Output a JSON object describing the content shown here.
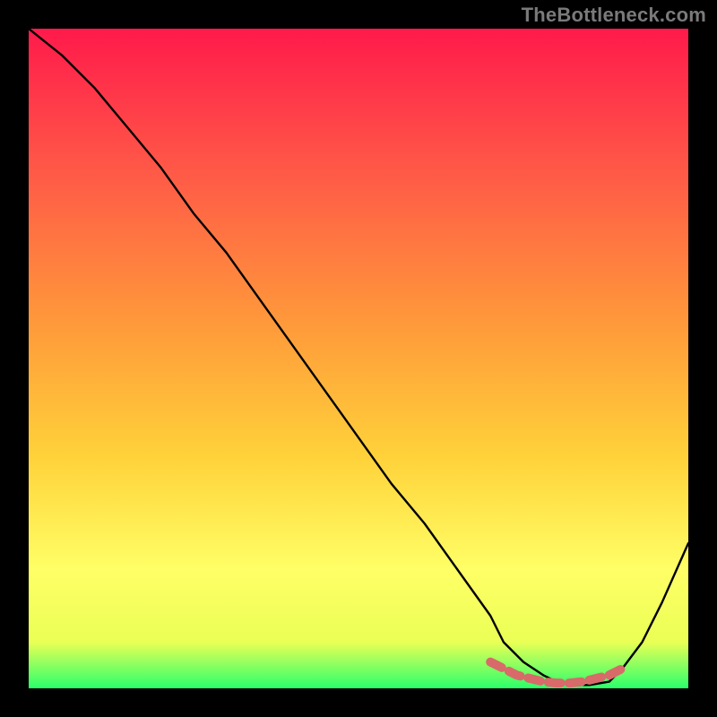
{
  "watermark": "TheBottleneck.com",
  "colors": {
    "bg": "#000000",
    "grad_top": "#ff1a4b",
    "grad_mid1": "#ff7a3a",
    "grad_mid2": "#ffd23a",
    "grad_mid3": "#ffff66",
    "grad_bottom": "#2bff6b",
    "curve": "#000000",
    "band": "#d86a6a"
  },
  "chart_data": {
    "type": "line",
    "title": "",
    "xlabel": "",
    "ylabel": "",
    "xlim": [
      0,
      100
    ],
    "ylim": [
      0,
      100
    ],
    "series": [
      {
        "name": "black-curve",
        "x": [
          0,
          5,
          10,
          15,
          20,
          25,
          30,
          35,
          40,
          45,
          50,
          55,
          60,
          65,
          70,
          72,
          75,
          78,
          80,
          83,
          85,
          88,
          90,
          93,
          96,
          100
        ],
        "values": [
          100,
          96,
          91,
          85,
          79,
          72,
          66,
          59,
          52,
          45,
          38,
          31,
          25,
          18,
          11,
          7,
          4,
          2,
          1,
          0.5,
          0.5,
          1,
          3,
          7,
          13,
          22
        ]
      },
      {
        "name": "pink-band",
        "x": [
          70,
          72,
          74,
          76,
          78,
          80,
          82,
          84,
          86,
          88,
          90
        ],
        "values": [
          4,
          3,
          2,
          1.5,
          1,
          0.8,
          0.8,
          1,
          1.5,
          2,
          3
        ]
      }
    ],
    "annotations": []
  }
}
